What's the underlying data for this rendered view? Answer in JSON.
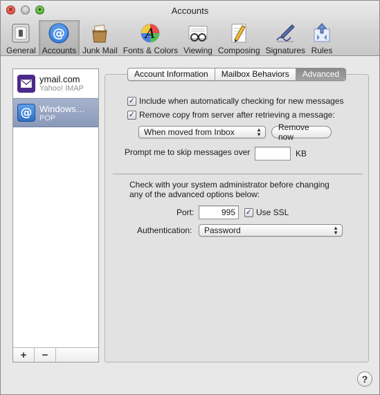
{
  "window": {
    "title": "Accounts"
  },
  "toolbar": {
    "items": [
      {
        "label": "General",
        "icon": "general-switch-icon",
        "selected": false
      },
      {
        "label": "Accounts",
        "icon": "at-sign-icon",
        "selected": true
      },
      {
        "label": "Junk Mail",
        "icon": "junk-mail-icon",
        "selected": false
      },
      {
        "label": "Fonts & Colors",
        "icon": "fonts-colors-icon",
        "selected": false
      },
      {
        "label": "Viewing",
        "icon": "glasses-icon",
        "selected": false
      },
      {
        "label": "Composing",
        "icon": "pencil-paper-icon",
        "selected": false
      },
      {
        "label": "Signatures",
        "icon": "signature-pen-icon",
        "selected": false
      },
      {
        "label": "Rules",
        "icon": "rules-icon",
        "selected": false
      }
    ]
  },
  "accounts": [
    {
      "name": "ymail.com",
      "type": "Yahoo! IMAP",
      "icon": "yahoo-mail-icon",
      "icon_color": "#4b2a8a",
      "selected": false
    },
    {
      "name": "Windows…",
      "type": "POP",
      "icon": "at-sign-icon",
      "icon_color": "#2d6fc4",
      "selected": true
    }
  ],
  "sidebar_buttons": {
    "add": "+",
    "remove": "−"
  },
  "tabs": [
    {
      "label": "Account Information",
      "active": false
    },
    {
      "label": "Mailbox Behaviors",
      "active": false
    },
    {
      "label": "Advanced",
      "active": true
    }
  ],
  "advanced": {
    "include_checking": {
      "label": "Include when automatically checking for new messages",
      "checked": true
    },
    "remove_copy": {
      "label": "Remove copy from server after retrieving a message:",
      "checked": true
    },
    "remove_when": {
      "value": "When moved from Inbox"
    },
    "remove_now_button": "Remove now",
    "prompt_skip": {
      "label": "Prompt me to skip messages over",
      "value": "",
      "unit": "KB"
    },
    "admin_note": "Check with your system administrator before changing any of the advanced options below:",
    "port": {
      "label": "Port:",
      "value": "995"
    },
    "use_ssl": {
      "label": "Use SSL",
      "checked": true
    },
    "authentication": {
      "label": "Authentication:",
      "value": "Password"
    }
  },
  "help_button": "?",
  "colors": {
    "selection": "#8a99b9",
    "active_tab": "#8a8a8a",
    "check": "#1b2e6e"
  }
}
